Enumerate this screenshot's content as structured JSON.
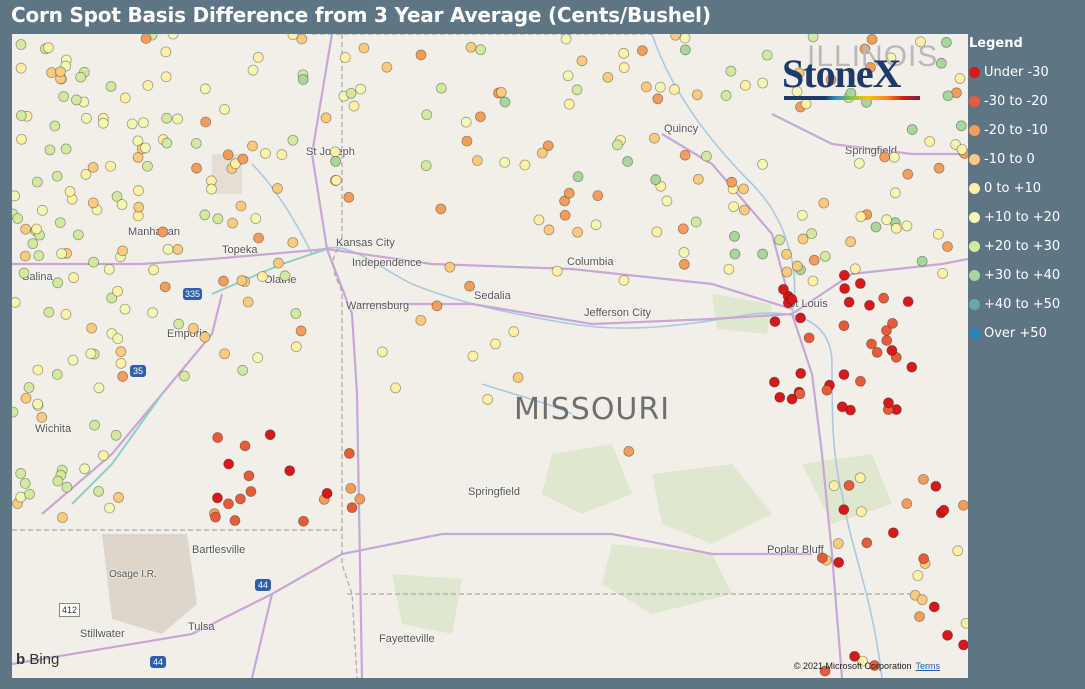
{
  "title": "Corn Spot Basis Difference from 3 Year Average (Cents/Bushel)",
  "legend": {
    "title": "Legend",
    "items": [
      {
        "label": "Under -30",
        "color": "#d7191c"
      },
      {
        "label": "-30 to -20",
        "color": "#e65c3a"
      },
      {
        "label": "-20 to -10",
        "color": "#f29e5a"
      },
      {
        "label": "-10 to 0",
        "color": "#fbca7c"
      },
      {
        "label": "0 to +10",
        "color": "#fff0a6"
      },
      {
        "label": "+10 to +20",
        "color": "#f2f7b2"
      },
      {
        "label": "+20 to +30",
        "color": "#d2ea9f"
      },
      {
        "label": "+30 to +40",
        "color": "#a8d69b"
      },
      {
        "label": "+40 to +50",
        "color": "#66aaa8"
      },
      {
        "label": "Over +50",
        "color": "#2b83ba"
      }
    ]
  },
  "map": {
    "state_label": "MISSOURI",
    "cities": [
      {
        "name": "St Joseph"
      },
      {
        "name": "Manhattan"
      },
      {
        "name": "Topeka"
      },
      {
        "name": "Kansas City"
      },
      {
        "name": "Independence"
      },
      {
        "name": "Olathe"
      },
      {
        "name": "Salina"
      },
      {
        "name": "Columbia"
      },
      {
        "name": "Sedalia"
      },
      {
        "name": "Warrensburg"
      },
      {
        "name": "Jefferson City"
      },
      {
        "name": "Emporia"
      },
      {
        "name": "Wichita"
      },
      {
        "name": "Springfield"
      },
      {
        "name": "Bartlesville"
      },
      {
        "name": "Osage I.R."
      },
      {
        "name": "Tulsa"
      },
      {
        "name": "Stillwater"
      },
      {
        "name": "Fayetteville"
      },
      {
        "name": "Poplar Bluff"
      },
      {
        "name": "St Louis"
      },
      {
        "name": "Quincy"
      },
      {
        "name": "Springfield"
      }
    ],
    "shields": [
      "335",
      "35",
      "44",
      "412",
      "44"
    ],
    "attribution": {
      "provider": "Bing",
      "copyright": "© 2021 Microsoft Corporation",
      "terms": "Terms"
    },
    "logo": "StoneX",
    "watermark": "ILLINOIS"
  }
}
